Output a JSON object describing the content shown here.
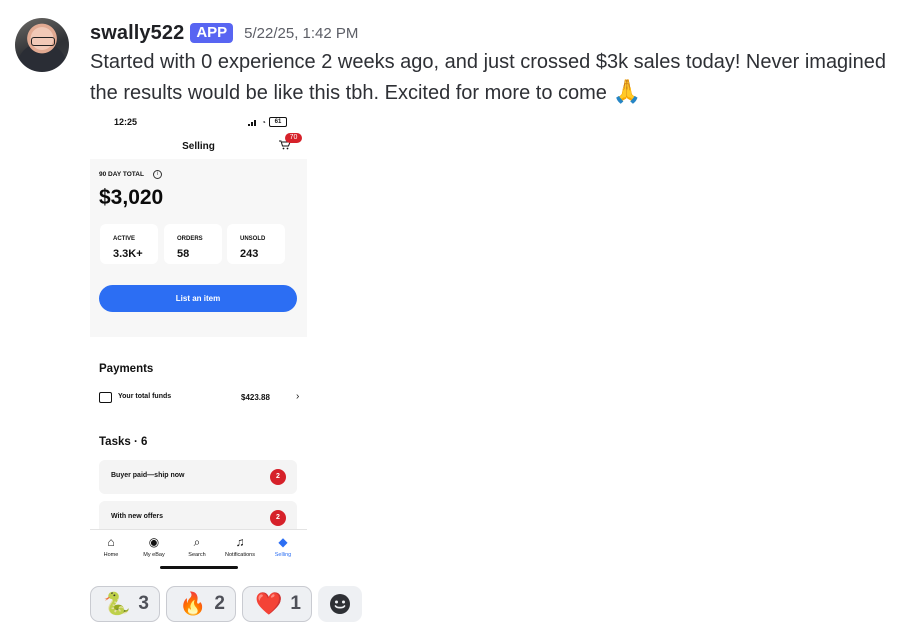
{
  "message": {
    "username": "swally522",
    "badge": "APP",
    "timestamp": "5/22/25, 1:42 PM",
    "text": "Started with 0 experience 2 weeks ago, and just crossed $3k sales today! Never imagined the results would be like this tbh. Excited for more to come",
    "emoji": "🙏"
  },
  "screenshot": {
    "status_time": "12:25",
    "battery": "61",
    "nav_title": "Selling",
    "cart_badge": "70",
    "summary_label": "90 DAY TOTAL",
    "summary_value": "$3,020",
    "stats": [
      {
        "label": "ACTIVE",
        "value": "3.3K+"
      },
      {
        "label": "ORDERS",
        "value": "58"
      },
      {
        "label": "UNSOLD",
        "value": "243"
      }
    ],
    "list_button": "List an item",
    "payments_title": "Payments",
    "funds_label": "Your total funds",
    "funds_value": "$423.88",
    "tasks_title": "Tasks · 6",
    "tasks": [
      {
        "label": "Buyer paid—ship now",
        "count": "2"
      },
      {
        "label": "With new offers",
        "count": "2"
      }
    ],
    "tabs": [
      {
        "label": "Home",
        "icon": "home-icon",
        "symbol": "⌂"
      },
      {
        "label": "My eBay",
        "icon": "profile-icon",
        "symbol": "◉"
      },
      {
        "label": "Search",
        "icon": "search-icon",
        "symbol": "⌕"
      },
      {
        "label": "Notifications",
        "icon": "bell-icon",
        "symbol": "♫"
      },
      {
        "label": "Selling",
        "icon": "tag-icon",
        "symbol": "◆"
      }
    ]
  },
  "reactions": [
    {
      "emoji": "🐍",
      "count": "3"
    },
    {
      "emoji": "🔥",
      "count": "2"
    },
    {
      "emoji": "❤️",
      "count": "1"
    }
  ],
  "colors": {
    "badge": "#5865f2",
    "accent_blue": "#2c6ef3",
    "alert_red": "#d6212a"
  }
}
